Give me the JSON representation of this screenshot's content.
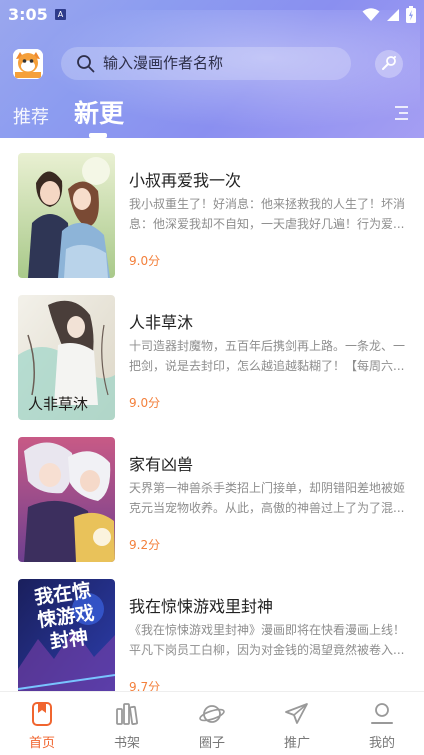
{
  "status_bar": {
    "time": "3:05",
    "badge": "A"
  },
  "header": {
    "logo_text": "漫画",
    "search_placeholder": "输入漫画作者名称",
    "tabs": [
      {
        "label": "推荐",
        "active": false
      },
      {
        "label": "新更",
        "active": true
      }
    ]
  },
  "comics": [
    {
      "title": "小叔再爱我一次",
      "description": "我小叔重生了！好消息：他来拯救我的人生了！坏消息：他深爱我却不自知，一天虐我好几遍！行为爱...",
      "score": "9.0分"
    },
    {
      "title": "人非草沐",
      "description": "十司造器封魔物，五百年后携剑再上路。一条龙、一把剑，说是去封印，怎么越追越黏糊了！【每周六...",
      "score": "9.0分",
      "cover_text": "人非草沐"
    },
    {
      "title": "家有凶兽",
      "description": "天界第一神兽杀手类招上门接单，却阴错阳差地被姬克元当宠物收养。从此，高傲的神兽过上了为了混...",
      "score": "9.2分"
    },
    {
      "title": "我在惊悚游戏里封神",
      "description": "《我在惊悚游戏里封神》漫画即将在快看漫画上线！平凡下岗员工白柳，因为对金钱的渴望竟然被卷入...",
      "score": "9.7分",
      "cover_text": "我在惊悚游戏封神"
    }
  ],
  "bottom_nav": [
    {
      "label": "首页",
      "icon": "home-bookmark-icon",
      "active": true
    },
    {
      "label": "书架",
      "icon": "bookshelf-icon",
      "active": false
    },
    {
      "label": "圈子",
      "icon": "planet-icon",
      "active": false
    },
    {
      "label": "推广",
      "icon": "paper-plane-icon",
      "active": false
    },
    {
      "label": "我的",
      "icon": "profile-icon",
      "active": false
    }
  ],
  "colors": {
    "header_gradient_start": "#9aa7ee",
    "header_gradient_end": "#a59ef3",
    "score": "#f3803c",
    "active_nav": "#f0652f"
  }
}
